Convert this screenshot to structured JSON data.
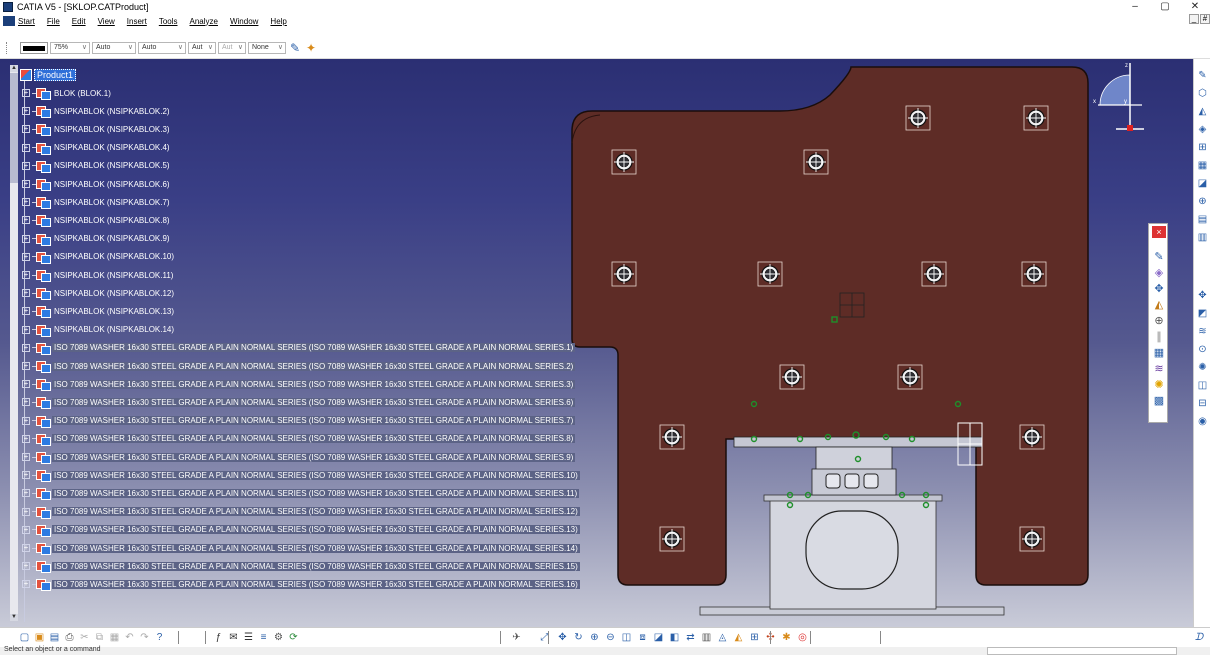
{
  "window": {
    "title": "CATIA V5 - [SKLOP.CATProduct]",
    "controls": [
      "–",
      "▢",
      "✕"
    ]
  },
  "menu": {
    "items": [
      "Start",
      "File",
      "Edit",
      "View",
      "Insert",
      "Tools",
      "Analyze",
      "Window",
      "Help"
    ],
    "mdi_controls": [
      "_",
      "#"
    ]
  },
  "format_toolbar": {
    "line_color": "#000000",
    "transparency": "75%",
    "line_weight": "Auto",
    "line_type": "Auto",
    "layer1": "Aut",
    "layer2": "Aut",
    "layer_filter": "None"
  },
  "tree": {
    "root": "Product1",
    "nodes": [
      "BLOK (BLOK.1)",
      "NSIPKABLOK (NSIPKABLOK.2)",
      "NSIPKABLOK (NSIPKABLOK.3)",
      "NSIPKABLOK (NSIPKABLOK.4)",
      "NSIPKABLOK (NSIPKABLOK.5)",
      "NSIPKABLOK (NSIPKABLOK.6)",
      "NSIPKABLOK (NSIPKABLOK.7)",
      "NSIPKABLOK (NSIPKABLOK.8)",
      "NSIPKABLOK (NSIPKABLOK.9)",
      "NSIPKABLOK (NSIPKABLOK.10)",
      "NSIPKABLOK (NSIPKABLOK.11)",
      "NSIPKABLOK (NSIPKABLOK.12)",
      "NSIPKABLOK (NSIPKABLOK.13)",
      "NSIPKABLOK (NSIPKABLOK.14)",
      "ISO 7089 WASHER 16x30 STEEL GRADE A PLAIN NORMAL SERIES (ISO 7089 WASHER 16x30 STEEL GRADE A PLAIN NORMAL SERIES.1)",
      "ISO 7089 WASHER 16x30 STEEL GRADE A PLAIN NORMAL SERIES (ISO 7089 WASHER 16x30 STEEL GRADE A PLAIN NORMAL SERIES.2)",
      "ISO 7089 WASHER 16x30 STEEL GRADE A PLAIN NORMAL SERIES (ISO 7089 WASHER 16x30 STEEL GRADE A PLAIN NORMAL SERIES.3)",
      "ISO 7089 WASHER 16x30 STEEL GRADE A PLAIN NORMAL SERIES (ISO 7089 WASHER 16x30 STEEL GRADE A PLAIN NORMAL SERIES.6)",
      "ISO 7089 WASHER 16x30 STEEL GRADE A PLAIN NORMAL SERIES (ISO 7089 WASHER 16x30 STEEL GRADE A PLAIN NORMAL SERIES.7)",
      "ISO 7089 WASHER 16x30 STEEL GRADE A PLAIN NORMAL SERIES (ISO 7089 WASHER 16x30 STEEL GRADE A PLAIN NORMAL SERIES.8)",
      "ISO 7089 WASHER 16x30 STEEL GRADE A PLAIN NORMAL SERIES (ISO 7089 WASHER 16x30 STEEL GRADE A PLAIN NORMAL SERIES.9)",
      "ISO 7089 WASHER 16x30 STEEL GRADE A PLAIN NORMAL SERIES (ISO 7089 WASHER 16x30 STEEL GRADE A PLAIN NORMAL SERIES.10)",
      "ISO 7089 WASHER 16x30 STEEL GRADE A PLAIN NORMAL SERIES (ISO 7089 WASHER 16x30 STEEL GRADE A PLAIN NORMAL SERIES.11)",
      "ISO 7089 WASHER 16x30 STEEL GRADE A PLAIN NORMAL SERIES (ISO 7089 WASHER 16x30 STEEL GRADE A PLAIN NORMAL SERIES.12)",
      "ISO 7089 WASHER 16x30 STEEL GRADE A PLAIN NORMAL SERIES (ISO 7089 WASHER 16x30 STEEL GRADE A PLAIN NORMAL SERIES.13)",
      "ISO 7089 WASHER 16x30 STEEL GRADE A PLAIN NORMAL SERIES (ISO 7089 WASHER 16x30 STEEL GRADE A PLAIN NORMAL SERIES.14)",
      "ISO 7089 WASHER 16x30 STEEL GRADE A PLAIN NORMAL SERIES (ISO 7089 WASHER 16x30 STEEL GRADE A PLAIN NORMAL SERIES.15)",
      "ISO 7089 WASHER 16x30 STEEL GRADE A PLAIN NORMAL SERIES (ISO 7089 WASHER 16x30 STEEL GRADE A PLAIN NORMAL SERIES.16)"
    ]
  },
  "compass": {
    "z": "z",
    "x": "x",
    "y": "y"
  },
  "status": {
    "message": "Select an object or a command"
  },
  "colors": {
    "part_fill": "#5e2c26",
    "part_edge": "#1a0d0b",
    "fixture": "#c9cbd6",
    "viewport_top": "#2b2f73",
    "viewport_bottom": "#c9cbd8",
    "selection": "#2f6fd8"
  },
  "icons": {
    "right_toolbar": [
      "sketch-icon",
      "plane-icon",
      "point-icon",
      "line-icon",
      "constraint-icon",
      "pattern-icon",
      "measure-icon",
      "analysis-icon",
      "scene-icon",
      "assembly-icon",
      "snap-icon",
      "explode-icon",
      "clash-icon",
      "section-icon",
      "annotation-icon",
      "render-icon",
      "view-icon",
      "material-icon"
    ],
    "bottom_toolbar": [
      "new-icon",
      "open-icon",
      "save-icon",
      "print-icon",
      "cut-icon",
      "copy-icon",
      "paste-icon",
      "undo-icon",
      "redo-icon",
      "whats-this-icon",
      "formula-icon",
      "comment-icon",
      "properties-icon",
      "layer-icon",
      "macro-icon",
      "update-icon",
      "fly-icon",
      "fit-all-icon",
      "pan-icon",
      "rotate-icon",
      "zoom-in-icon",
      "zoom-out-icon",
      "normal-view-icon",
      "views-icon",
      "render-style-icon",
      "hide-show-icon",
      "swap-icon",
      "catalog-icon",
      "measure-icon",
      "analysis-icon",
      "space-icon",
      "move-icon",
      "clash-icon",
      "snap-icon"
    ]
  }
}
